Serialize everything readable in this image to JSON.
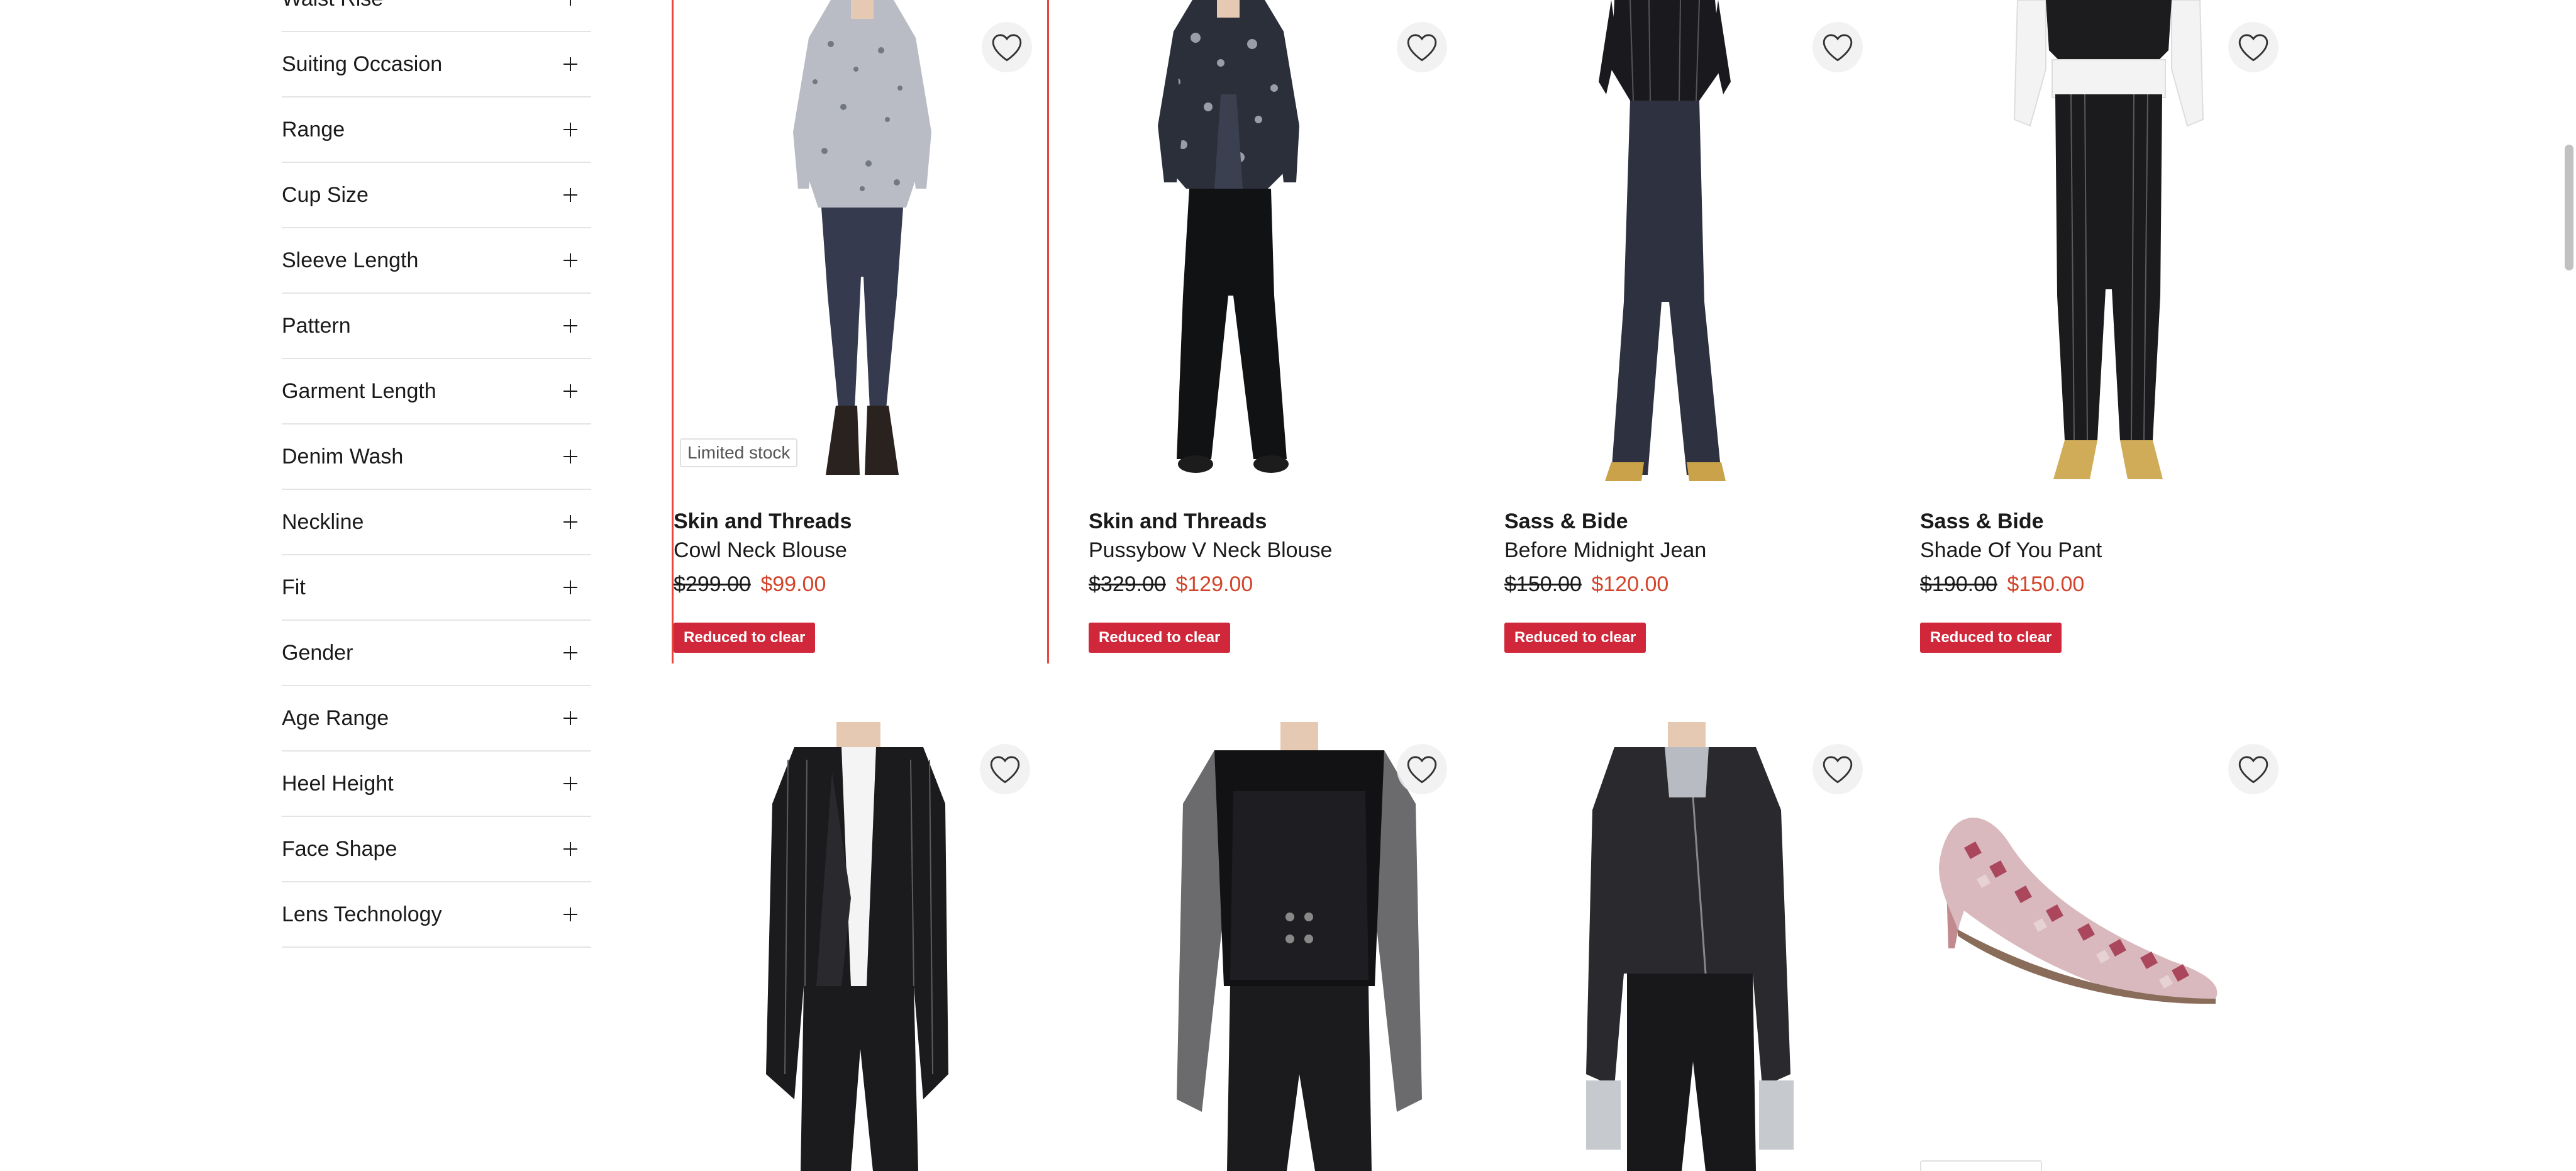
{
  "filters": [
    {
      "label": "Waist Rise"
    },
    {
      "label": "Suiting Occasion"
    },
    {
      "label": "Range"
    },
    {
      "label": "Cup Size"
    },
    {
      "label": "Sleeve Length"
    },
    {
      "label": "Pattern"
    },
    {
      "label": "Garment Length"
    },
    {
      "label": "Denim Wash"
    },
    {
      "label": "Neckline"
    },
    {
      "label": "Fit"
    },
    {
      "label": "Gender"
    },
    {
      "label": "Age Range"
    },
    {
      "label": "Heel Height"
    },
    {
      "label": "Face Shape"
    },
    {
      "label": "Lens Technology"
    }
  ],
  "products": [
    {
      "brand": "Skin and Threads",
      "name": "Cowl Neck Blouse",
      "was": "$299.00",
      "now": "$99.00",
      "badge": "Reduced to clear",
      "stock": "Limited stock"
    },
    {
      "brand": "Skin and Threads",
      "name": "Pussybow V Neck Blouse",
      "was": "$329.00",
      "now": "$129.00",
      "badge": "Reduced to clear"
    },
    {
      "brand": "Sass & Bide",
      "name": "Before Midnight Jean",
      "was": "$150.00",
      "now": "$120.00",
      "badge": "Reduced to clear"
    },
    {
      "brand": "Sass & Bide",
      "name": "Shade Of You Pant",
      "was": "$190.00",
      "now": "$150.00",
      "badge": "Reduced to clear"
    }
  ],
  "icons": {
    "filter_expand": "plus-icon",
    "wishlist": "heart-outline-icon"
  },
  "colors": {
    "sale_price": "#d2452b",
    "clear_badge": "#d0283a",
    "selected_outline": "#e8473c"
  }
}
